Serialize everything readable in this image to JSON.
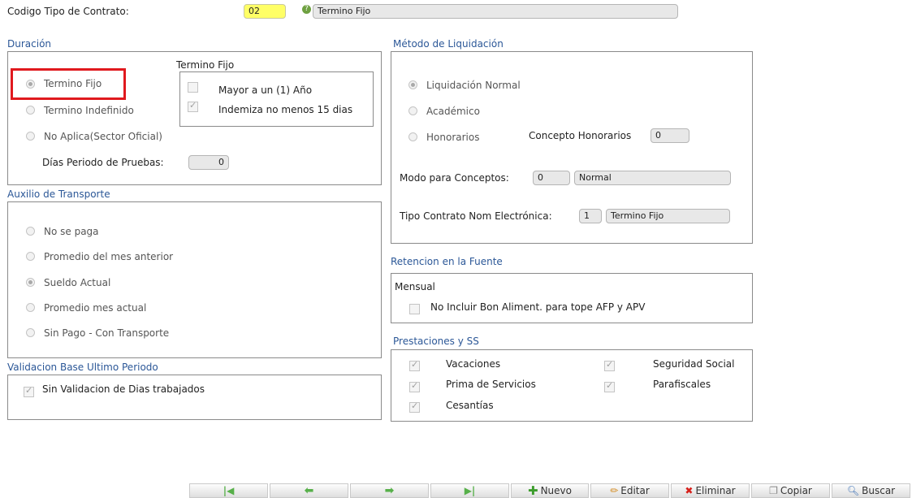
{
  "header": {
    "codigo_label": "Codigo Tipo de Contrato:",
    "codigo_value": "02",
    "tipo_name": "Termino Fijo"
  },
  "duracion": {
    "title": "Duración",
    "options": [
      "Termino Fijo",
      "Termino Indefinido",
      "No Aplica(Sector Oficial)"
    ],
    "selected": "Termino Fijo",
    "prueba_label": "Días Periodo de Pruebas:",
    "prueba_value": "0",
    "fijo_group": {
      "title": "Termino Fijo",
      "mayor": "Mayor a un (1) Año",
      "indemniza": "Indemiza no menos 15 dias"
    }
  },
  "auxilio": {
    "title": "Auxilio de Transporte",
    "options": [
      "No se paga",
      "Promedio del mes anterior",
      "Sueldo Actual",
      "Promedio mes actual",
      "Sin Pago - Con Transporte"
    ],
    "selected": "Sueldo Actual"
  },
  "validacion": {
    "title": "Validacion Base Ultimo Periodo",
    "check_label": "Sin Validacion de Dias trabajados"
  },
  "metodo": {
    "title": "Método de Liquidación",
    "options": [
      "Liquidación Normal",
      "Académico",
      "Honorarios"
    ],
    "selected": "Liquidación Normal",
    "concepto_label": "Concepto Honorarios",
    "concepto_value": "0",
    "modo_label": "Modo para Conceptos:",
    "modo_code": "0",
    "modo_name": "Normal",
    "tipo_nom_label": "Tipo Contrato Nom Electrónica:",
    "tipo_nom_code": "1",
    "tipo_nom_name": "Termino Fijo"
  },
  "retencion": {
    "title": "Retencion en la Fuente",
    "sub": "Mensual",
    "check_label": "No Incluir Bon Aliment. para tope AFP y APV"
  },
  "prestaciones": {
    "title": "Prestaciones y SS",
    "vacaciones": "Vacaciones",
    "prima": "Prima de Servicios",
    "cesantias": "Cesantías",
    "seguridad": "Seguridad Social",
    "parafiscales": "Parafiscales"
  },
  "toolbar": {
    "nuevo": "Nuevo",
    "editar": "Editar",
    "eliminar": "Eliminar",
    "copiar": "Copiar",
    "buscar": "Buscar"
  },
  "colors": {
    "section_title": "#2b5797",
    "highlight": "#e0191e",
    "code_field": "#ffff66"
  }
}
